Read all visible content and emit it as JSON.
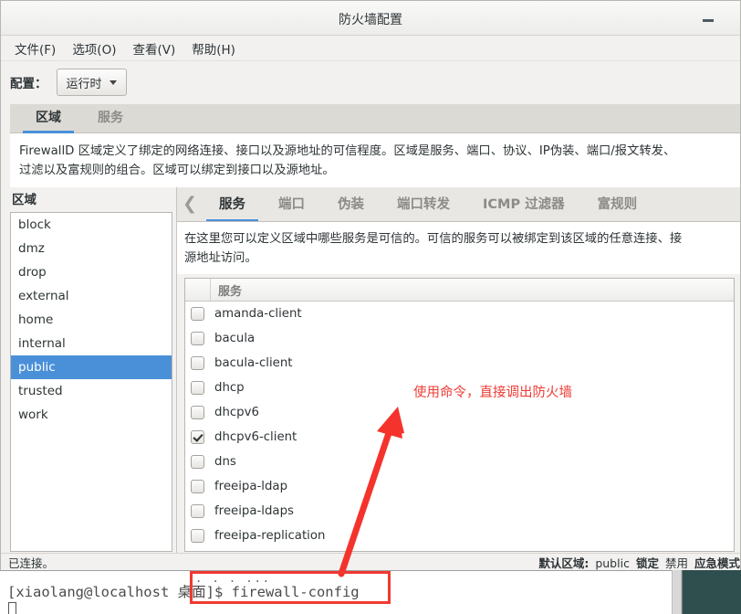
{
  "window": {
    "title": "防火墙配置",
    "minimize_icon": "minimize-icon"
  },
  "menubar": {
    "items": [
      {
        "label": "文件(F)"
      },
      {
        "label": "选项(O)"
      },
      {
        "label": "查看(V)"
      },
      {
        "label": "帮助(H)"
      }
    ]
  },
  "toolbar": {
    "config_label": "配置：",
    "config_value": "运行时"
  },
  "outer_tabs": [
    {
      "label": "区域",
      "active": true
    },
    {
      "label": "服务",
      "active": false
    }
  ],
  "zone_description": {
    "line1": "FirewallD 区域定义了绑定的网络连接、接口以及源地址的可信程度。区域是服务、端口、协议、IP伪装、端口/报文转发、",
    "line2": "过滤以及富规则的组合。区域可以绑定到接口以及源地址。"
  },
  "zone_panel": {
    "heading": "区域",
    "items": [
      {
        "label": "block",
        "selected": false
      },
      {
        "label": "dmz",
        "selected": false
      },
      {
        "label": "drop",
        "selected": false
      },
      {
        "label": "external",
        "selected": false
      },
      {
        "label": "home",
        "selected": false
      },
      {
        "label": "internal",
        "selected": false
      },
      {
        "label": "public",
        "selected": true
      },
      {
        "label": "trusted",
        "selected": false
      },
      {
        "label": "work",
        "selected": false
      }
    ]
  },
  "inner_tabs": {
    "scroll_left_icon": "chevron-left-icon",
    "items": [
      {
        "label": "服务",
        "active": true
      },
      {
        "label": "端口",
        "active": false
      },
      {
        "label": "伪装",
        "active": false
      },
      {
        "label": "端口转发",
        "active": false
      },
      {
        "label": "ICMP 过滤器",
        "active": false
      },
      {
        "label": "富规则",
        "active": false
      }
    ]
  },
  "service_description": {
    "line1": "在这里您可以定义区域中哪些服务是可信的。可信的服务可以被绑定到该区域的任意连接、接",
    "line2": "源地址访问。"
  },
  "service_table": {
    "header": "服务",
    "rows": [
      {
        "name": "amanda-client",
        "checked": false
      },
      {
        "name": "bacula",
        "checked": false
      },
      {
        "name": "bacula-client",
        "checked": false
      },
      {
        "name": "dhcp",
        "checked": false
      },
      {
        "name": "dhcpv6",
        "checked": false
      },
      {
        "name": "dhcpv6-client",
        "checked": true
      },
      {
        "name": "dns",
        "checked": false
      },
      {
        "name": "freeipa-ldap",
        "checked": false
      },
      {
        "name": "freeipa-ldaps",
        "checked": false
      },
      {
        "name": "freeipa-replication",
        "checked": false
      }
    ]
  },
  "statusbar": {
    "connection": "已连接。",
    "default_zone_label": "默认区域:",
    "default_zone_value": "public",
    "lock_label": "锁定",
    "disabled_label": "禁用",
    "panic_label": "应急模式"
  },
  "terminal": {
    "dots": ".  .  . ...",
    "prompt_line": "[xiaolang@localhost 桌面]$ firewall-config"
  },
  "annotations": {
    "note_text": "使用命令，直接调出防火墙",
    "accent_color": "#ee3a33"
  }
}
